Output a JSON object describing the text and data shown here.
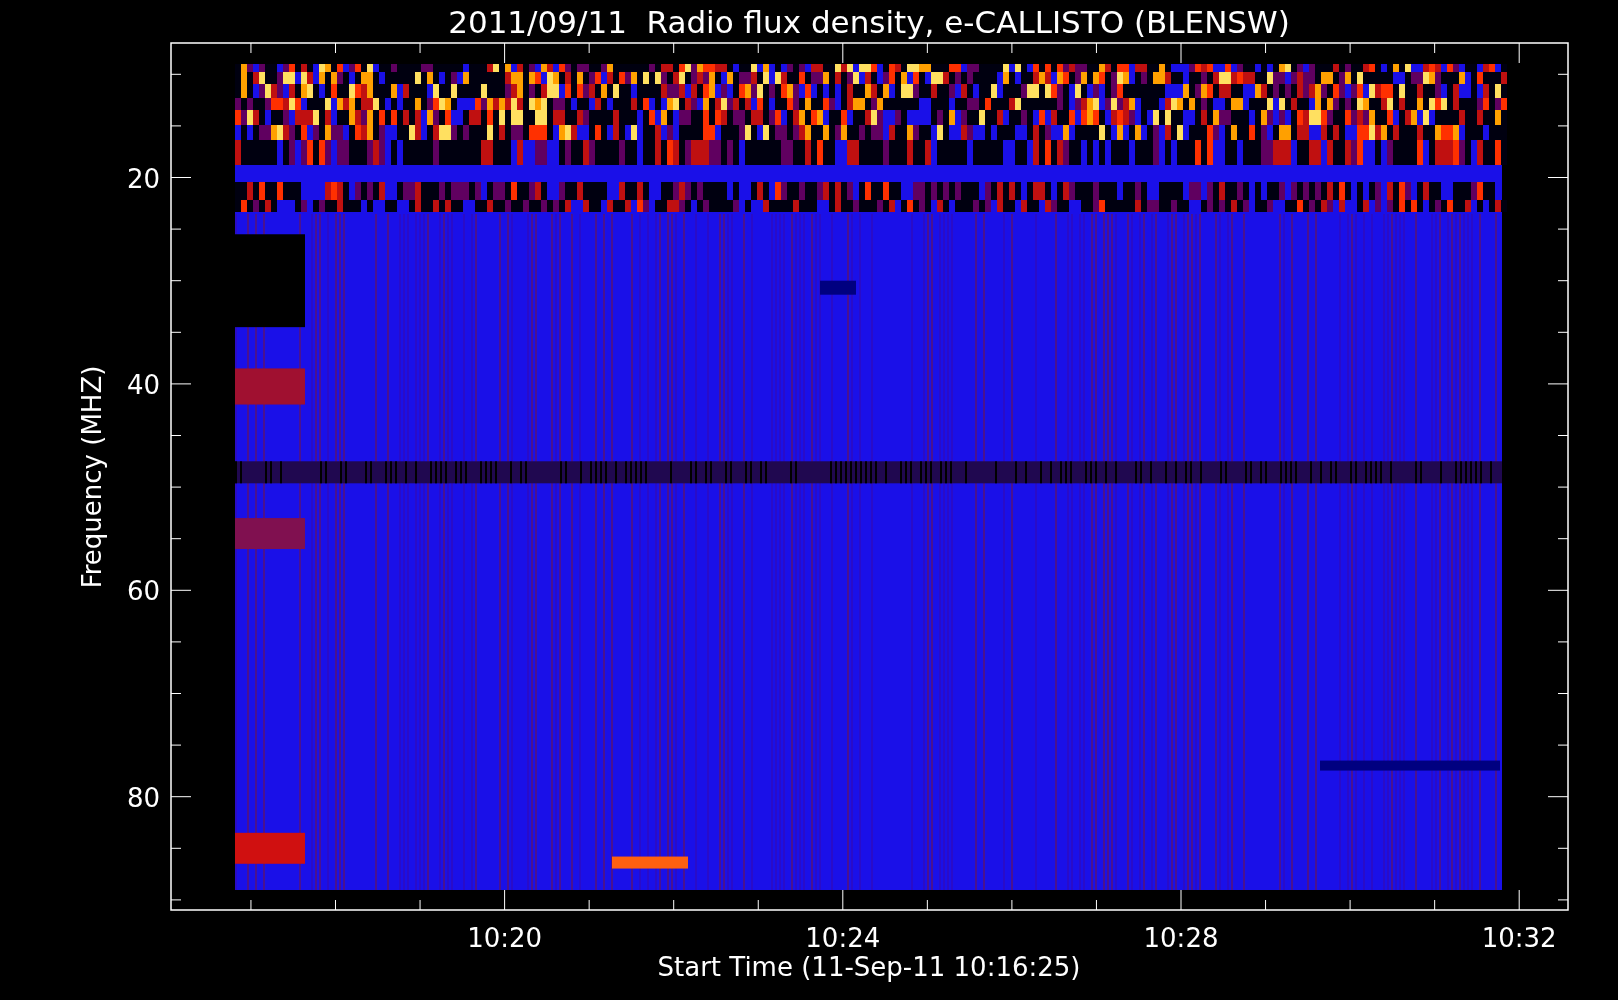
{
  "title": "2011/09/11  Radio flux density, e-CALLISTO (BLENSW)",
  "y_axis": {
    "label": "Frequency (MHZ)",
    "ticks": [
      "20",
      "40",
      "60",
      "80"
    ]
  },
  "x_axis": {
    "label": "Start Time (11-Sep-11 10:16:25)",
    "ticks": [
      "10:20",
      "10:24",
      "10:28",
      "10:32"
    ]
  }
}
